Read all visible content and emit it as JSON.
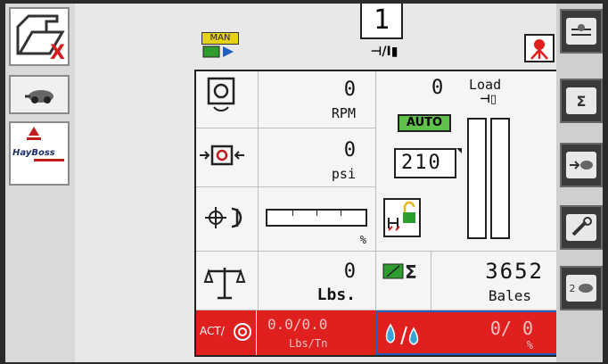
{
  "header": {
    "man_label": "MAN",
    "bale_count_label": "1",
    "bale_count_sub": "⊣/Ⅰ▮"
  },
  "left_buttons": [
    {
      "name": "folder-delete",
      "label": "X"
    },
    {
      "name": "speed"
    },
    {
      "name": "hayboss-logo",
      "label": "HayBoss"
    }
  ],
  "right_buttons": [
    {
      "name": "auto-tie"
    },
    {
      "name": "bale-total",
      "label": "Σ"
    },
    {
      "name": "machine-settings"
    },
    {
      "name": "wrench"
    },
    {
      "name": "second-bale",
      "label": "2"
    }
  ],
  "rpm": {
    "value": "0",
    "unit": "RPM"
  },
  "pressure": {
    "value": "0",
    "unit": "psi"
  },
  "moisture_bar": {
    "unit": "%",
    "level": 0
  },
  "load": {
    "value": "0",
    "label": "Load",
    "sub": "⊣▯",
    "mode": "AUTO",
    "setpoint": "210"
  },
  "weight": {
    "value": "0",
    "unit": "Lbs."
  },
  "bales": {
    "value": "3652",
    "unit": "Bales"
  },
  "act_rate": {
    "label": "ACT/",
    "value": "0.0/0.0",
    "unit": "Lbs/Tn"
  },
  "preservative": {
    "value": "0/ 0",
    "unit": "%"
  },
  "colors": {
    "red": "#e01f1f",
    "blue": "#1f5fbf",
    "green": "#33aa33",
    "panel": "#f5f5f5"
  }
}
